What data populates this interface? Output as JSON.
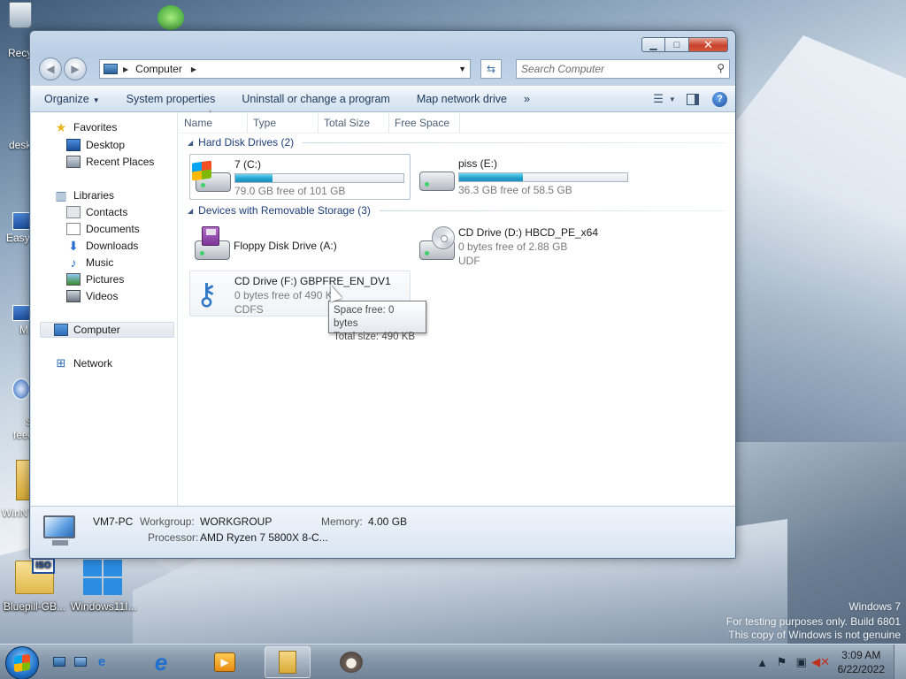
{
  "desktop": {
    "icons": [
      {
        "label": "Recy"
      },
      {
        "label": "desk"
      },
      {
        "label": "Easyb"
      },
      {
        "label": "M"
      },
      {
        "label": "S feed"
      },
      {
        "label": "WinNT"
      },
      {
        "label": "Bluepill-GB..."
      },
      {
        "label": "Windows11I..."
      }
    ],
    "watermark": {
      "line1": "Windows 7",
      "line2": "For testing purposes only. Build 6801",
      "line3": "This copy of Windows is not genuine"
    }
  },
  "window": {
    "address": {
      "crumb": "Computer"
    },
    "search": {
      "placeholder": "Search Computer"
    },
    "toolbar": {
      "organize": "Organize",
      "system_properties": "System properties",
      "uninstall": "Uninstall or change a program",
      "map_drive": "Map network drive",
      "more": "»"
    },
    "nav": {
      "favorites": "Favorites",
      "desktop": "Desktop",
      "recent_places": "Recent Places",
      "libraries": "Libraries",
      "contacts": "Contacts",
      "documents": "Documents",
      "downloads": "Downloads",
      "music": "Music",
      "pictures": "Pictures",
      "videos": "Videos",
      "computer": "Computer",
      "network": "Network"
    },
    "columns": {
      "name": "Name",
      "type": "Type",
      "total_size": "Total Size",
      "free_space": "Free Space"
    },
    "groups": {
      "hard_disks": "Hard Disk Drives (2)",
      "removable": "Devices with Removable Storage (3)"
    },
    "drives": {
      "c": {
        "name": "7 (C:)",
        "free": "79.0 GB free of 101 GB",
        "used_fraction": 0.22
      },
      "e": {
        "name": "piss (E:)",
        "free": "36.3 GB free of 58.5 GB",
        "used_fraction": 0.38
      },
      "a": {
        "name": "Floppy Disk Drive (A:)"
      },
      "d": {
        "name": "CD Drive (D:) HBCD_PE_x64",
        "free": "0 bytes free of 2.88 GB",
        "fs": "UDF"
      },
      "f": {
        "name": "CD Drive (F:) GBPFRE_EN_DV1",
        "free": "0 bytes free of 490 K",
        "fs": "CDFS"
      }
    },
    "tooltip": {
      "line1": "Space free: 0 bytes",
      "line2": "Total size: 490 KB"
    },
    "details": {
      "pc_name": "VM7-PC",
      "workgroup_label": "Workgroup:",
      "workgroup": "WORKGROUP",
      "memory_label": "Memory:",
      "memory": "4.00 GB",
      "processor_label": "Processor:",
      "processor": "AMD Ryzen 7 5800X 8-C..."
    }
  },
  "taskbar": {
    "time": "3:09 AM",
    "date": "6/22/2022"
  }
}
